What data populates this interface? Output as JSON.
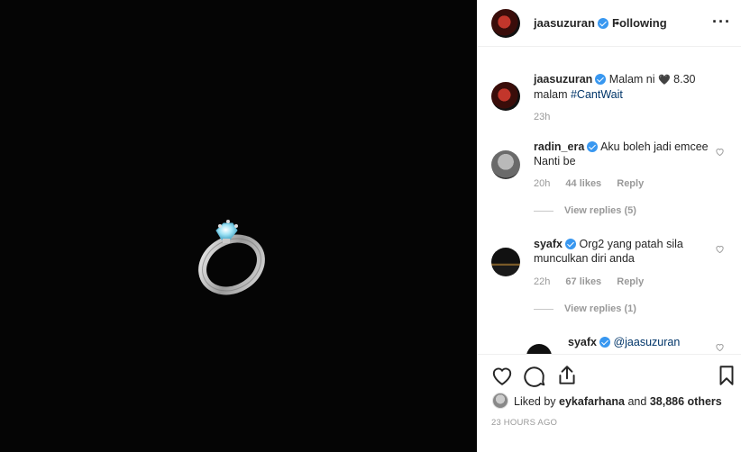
{
  "post": {
    "author": "jaasuzuran",
    "follow_status": "Following",
    "separator": "•",
    "more_label": "···"
  },
  "caption": {
    "username": "jaasuzuran",
    "text_before": "Malam ni ",
    "heart": "🖤",
    "text_after": " 8.30 malam ",
    "hashtag": "#CantWait",
    "time": "23h"
  },
  "comments": [
    {
      "username": "radin_era",
      "text": "Aku boleh jadi emcee Nanti be",
      "time": "20h",
      "likes": "44 likes",
      "reply": "Reply",
      "view_replies": "View replies (5)"
    },
    {
      "username": "syafx",
      "text": "Org2 yang patah sila munculkan diri anda",
      "time": "22h",
      "likes": "67 likes",
      "reply": "Reply",
      "view_replies": "View replies (1)"
    },
    {
      "username": "syafx",
      "mention": "@jaasuzuran"
    }
  ],
  "actions": {
    "liked_by_prefix": "Liked by ",
    "liked_by_user": "eykafarhana",
    "liked_by_and": " and ",
    "liked_by_count": "38,886 others",
    "timestamp": "23 HOURS AGO"
  },
  "icons": {
    "like": "heart-outline-icon",
    "comment": "comment-bubble-icon",
    "share": "share-icon",
    "save": "bookmark-icon"
  },
  "colors": {
    "verified": "#3897f0",
    "hashtag": "#003569",
    "media_bg": "#050505"
  }
}
